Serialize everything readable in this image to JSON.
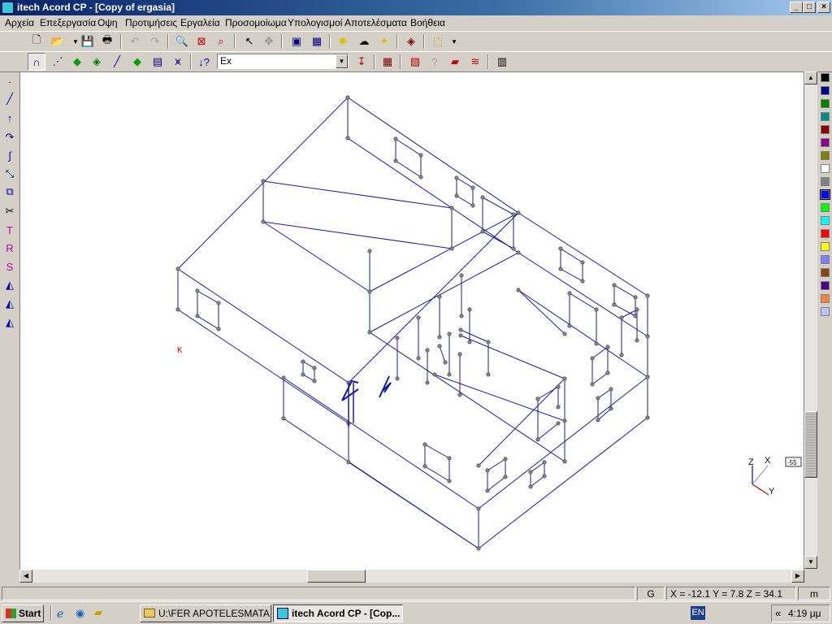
{
  "window": {
    "title": "itech Acord CP - [Copy of ergasia]"
  },
  "menu": [
    "Αρχεία",
    "Επεξεργασία",
    "Οψη",
    "Προτιμήσεις",
    "Εργαλεία",
    "Προσομοίωμα",
    "Υπολογισμοί",
    "Αποτελέσματα",
    "Βοήθεια"
  ],
  "toolbar2": {
    "load_case": "Ex"
  },
  "view": {
    "axis_z": "Z",
    "axis_x": "X",
    "axis_y": "Y",
    "angle": "-55",
    "origin_mark": "K"
  },
  "status": {
    "grid": "G",
    "coords": "X = -12.1  Y = 7.8  Z = 34.1",
    "units": "m"
  },
  "taskbar": {
    "start": "Start",
    "task1": "U:\\FER APOTELESMATA",
    "task2": "itech Acord CP - [Cop...",
    "lang": "EN",
    "clock": "4:19 μμ"
  },
  "palette_colors": [
    "#000000",
    "#00008b",
    "#008000",
    "#008b8b",
    "#8b0000",
    "#8b008b",
    "#808000",
    "#ffffff",
    "#808080",
    "#0000ff",
    "#00ff00",
    "#00ffff",
    "#ff0000",
    "#ffff00",
    "#8080ff",
    "#8b4513",
    "#4b0082",
    "#ff8040",
    "#c0c0ff"
  ]
}
